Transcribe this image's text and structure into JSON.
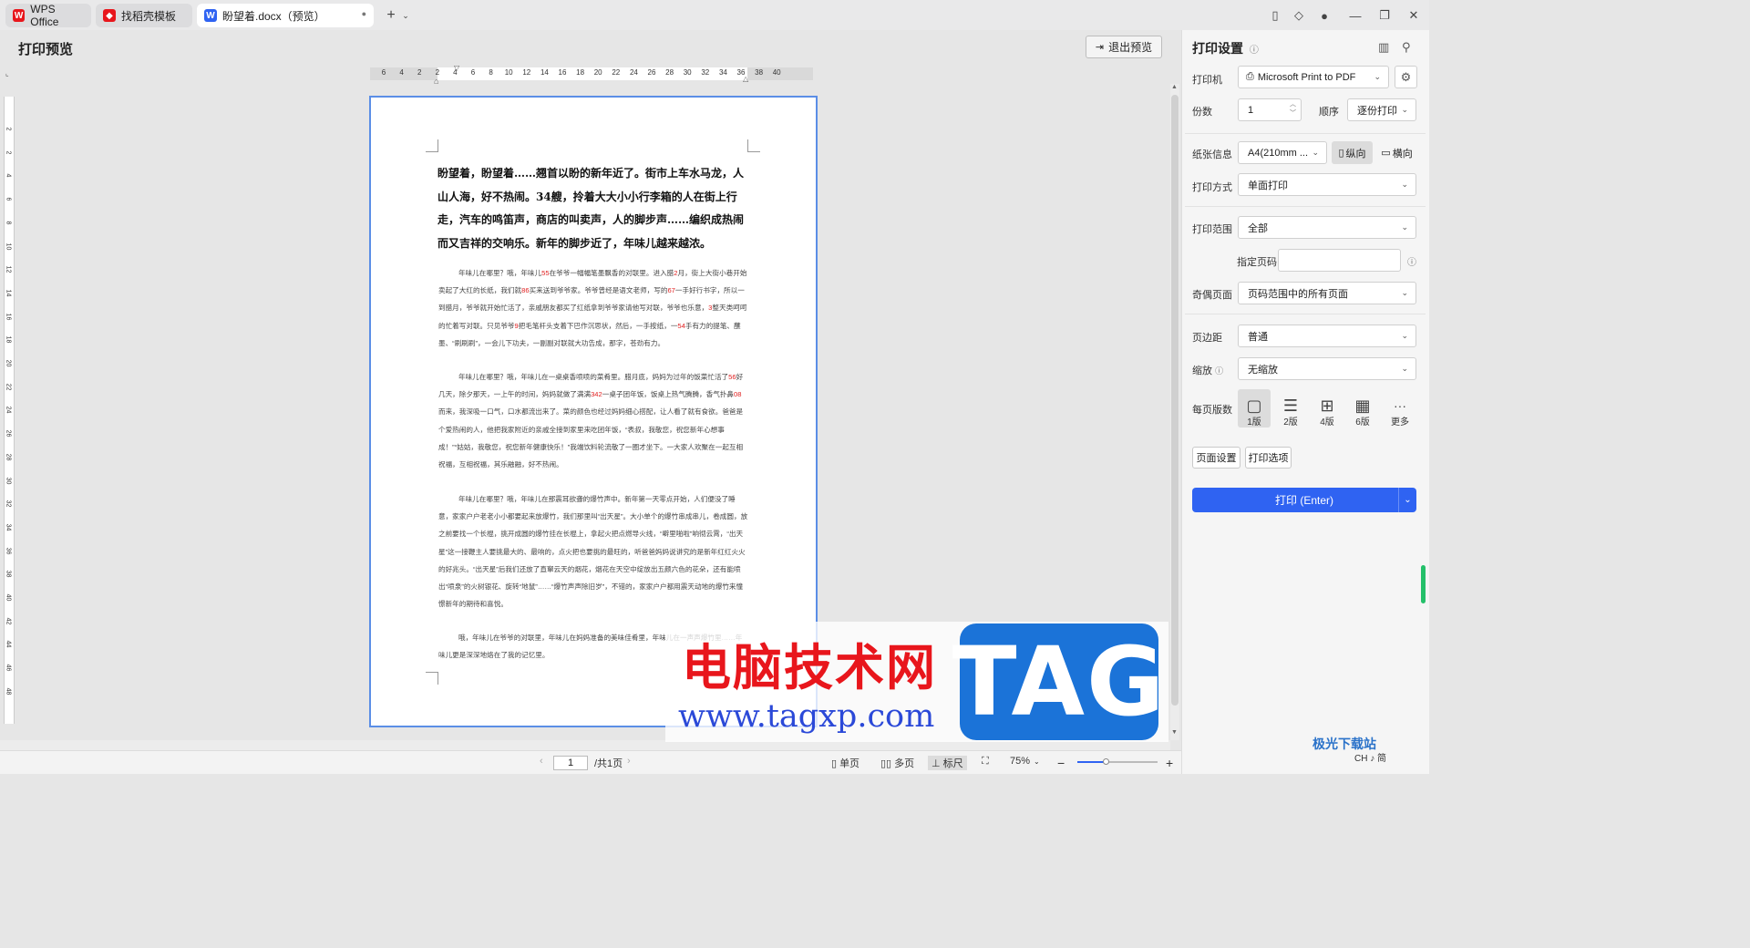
{
  "tabs": [
    {
      "label": "WPS Office",
      "icon": "wps-logo-icon"
    },
    {
      "label": "找稻壳模板",
      "icon": "docer-icon"
    },
    {
      "label": "盼望着.docx（预览）",
      "icon": "word-doc-icon"
    }
  ],
  "toolbar": {
    "title": "打印预览",
    "exit_label": "退出预览"
  },
  "ruler": {
    "h_ticks": [
      "6",
      "4",
      "2",
      "2",
      "4",
      "6",
      "8",
      "10",
      "12",
      "14",
      "16",
      "18",
      "20",
      "22",
      "24",
      "26",
      "28",
      "30",
      "32",
      "34",
      "36",
      "38",
      "40"
    ],
    "v_ticks": [
      "2",
      "2",
      "4",
      "6",
      "8",
      "10",
      "12",
      "14",
      "16",
      "18",
      "20",
      "22",
      "24",
      "26",
      "28",
      "30",
      "32",
      "34",
      "36",
      "38",
      "40",
      "42",
      "44",
      "46",
      "48"
    ]
  },
  "document": {
    "heading": "盼望着，盼望着……翘首以盼的新年近了。街市上车水马龙，人山人海，好不热闹。34艘，拎着大大小小行李箱的人在街上行走，汽车的鸣笛声，商店的叫卖声，人的脚步声……编织成热闹而又吉祥的交响乐。新年的脚步近了，年味儿越来越浓。",
    "p1": [
      {
        "t": "年味儿在哪里？哦，年味儿"
      },
      {
        "t": "55",
        "red": true
      },
      {
        "t": "在爷爷一幅幅笔墨飘香的对联里。进入腊"
      },
      {
        "t": "2",
        "red": true
      },
      {
        "t": "月，街上大街小巷开始卖起了大红的长纸，我们就"
      },
      {
        "t": "86",
        "red": true
      },
      {
        "t": "买来送到爷爷家。爷爷曾经是语文老师，写的"
      },
      {
        "t": "67",
        "red": true
      },
      {
        "t": "一手好行书字，所以一到腊月，爷爷就开始忙活了，亲戚朋友都买了红纸拿到爷爷家请他写对联，爷爷也乐意，"
      },
      {
        "t": "3",
        "red": true
      },
      {
        "t": "整天类呵呵的忙着写对联。只见爷爷"
      },
      {
        "t": "9",
        "red": true
      },
      {
        "t": "把毛笔杆头支着下巴作沉思状，然后，一手按纸，一"
      },
      {
        "t": "54",
        "red": true
      },
      {
        "t": "手有力的提笔、蘸墨、“刷刷刷”，一会儿下功夫，一副副对联就大功告成，那字，苍劲有力。"
      }
    ],
    "p2": [
      {
        "t": "年味儿在哪里？哦，年味儿在一桌桌香喷喷的菜肴里。腊月底，妈妈为过年的饭菜忙活了"
      },
      {
        "t": "56",
        "red": true
      },
      {
        "t": "好几天，除夕那天，一上午的时间，妈妈就做了满满"
      },
      {
        "t": "342",
        "red": true
      },
      {
        "t": "一桌子团年饭，饭桌上热气腾腾，香气扑鼻"
      },
      {
        "t": "08",
        "red": true
      },
      {
        "t": "而来，我深吸一口气，口水都流出来了。菜的颜色也经过妈妈细心搭配，让人看了就有食欲。爸爸是个爱热闹的人，他把我家附近的亲戚全接到家里来吃团年饭，“表叔，我敬您，祝您新年心想事成！”“姑姑，我敬您，祝您新年健康快乐！”我端饮料轮流敬了一圈才坐下。一大家人欢聚在一起互相祝福，互相祝福，其乐融融，好不热闹。"
      }
    ],
    "p3": "年味儿在哪里？哦，年味儿在那震耳欲聋的爆竹声中。新年第一天零点开始，人们便没了睡意，家家户户老老小小都要起来放爆竹，我们那里叫“出天星”。大小单个的爆竹串成串儿，卷成圆，放之前要找一个长棍，挑开成圆的爆竹挂在长棍上，拿起火把点燃导火线，“噼里啪啦”响彻云霄，“出天星”这一接鞭主人要挑最大的、最响的，点火把也要挑的最旺的，听爸爸妈妈说讲究的是新年红红火火的好兆头。“出天星”后我们还放了直窜云天的烟花，烟花在天空中绽放出五颜六色的花朵，还有能喷出“喷泉”的火树银花、旋转“地鼠”……“爆竹声声除旧岁”，不错的，家家户户都用震天动地的爆竹来憧憬新年的期待和喜悦。",
    "p4": "哦，年味儿在爷爷的对联里，年味儿在妈妈准备的美味佳肴里，年味儿在一声声爆竹里……年味儿更是深深地烙在了我的记忆里。"
  },
  "status": {
    "page": "1",
    "total": "/共1页",
    "single": "单页",
    "multi": "多页",
    "ruler": "标尺",
    "zoom": "75%",
    "ime": "CH ♪ 简"
  },
  "panel": {
    "title": "打印设置",
    "printer_label": "打印机",
    "printer_value": "Microsoft Print to PDF",
    "copies_label": "份数",
    "copies_value": "1",
    "order_label": "顺序",
    "order_value": "逐份打印",
    "paper_label": "纸张信息",
    "paper_value": "A4(210mm ...",
    "portrait": "纵向",
    "landscape": "横向",
    "mode_label": "打印方式",
    "mode_value": "单面打印",
    "range_label": "打印范围",
    "range_value": "全部",
    "pages_label": "指定页码",
    "oddeven_label": "奇偶页面",
    "oddeven_value": "页码范围中的所有页面",
    "margin_label": "页边距",
    "margin_value": "普通",
    "scale_label": "缩放",
    "scale_value": "无缩放",
    "perpage_label": "每页版数",
    "layouts": [
      "1版",
      "2版",
      "4版",
      "6版",
      "更多"
    ],
    "page_setup": "页面设置",
    "print_options": "打印选项",
    "print_button": "打印 (Enter)"
  },
  "watermark": {
    "text": "电脑技术网",
    "url": "www.tagxp.com",
    "logo": "TAG",
    "corner_logo": "极光下载站"
  },
  "colors": {
    "accent": "#2f63f2",
    "page_border": "#5b8ee6",
    "watermark_red": "#e8161c",
    "tag_blue": "#1b73d8"
  }
}
